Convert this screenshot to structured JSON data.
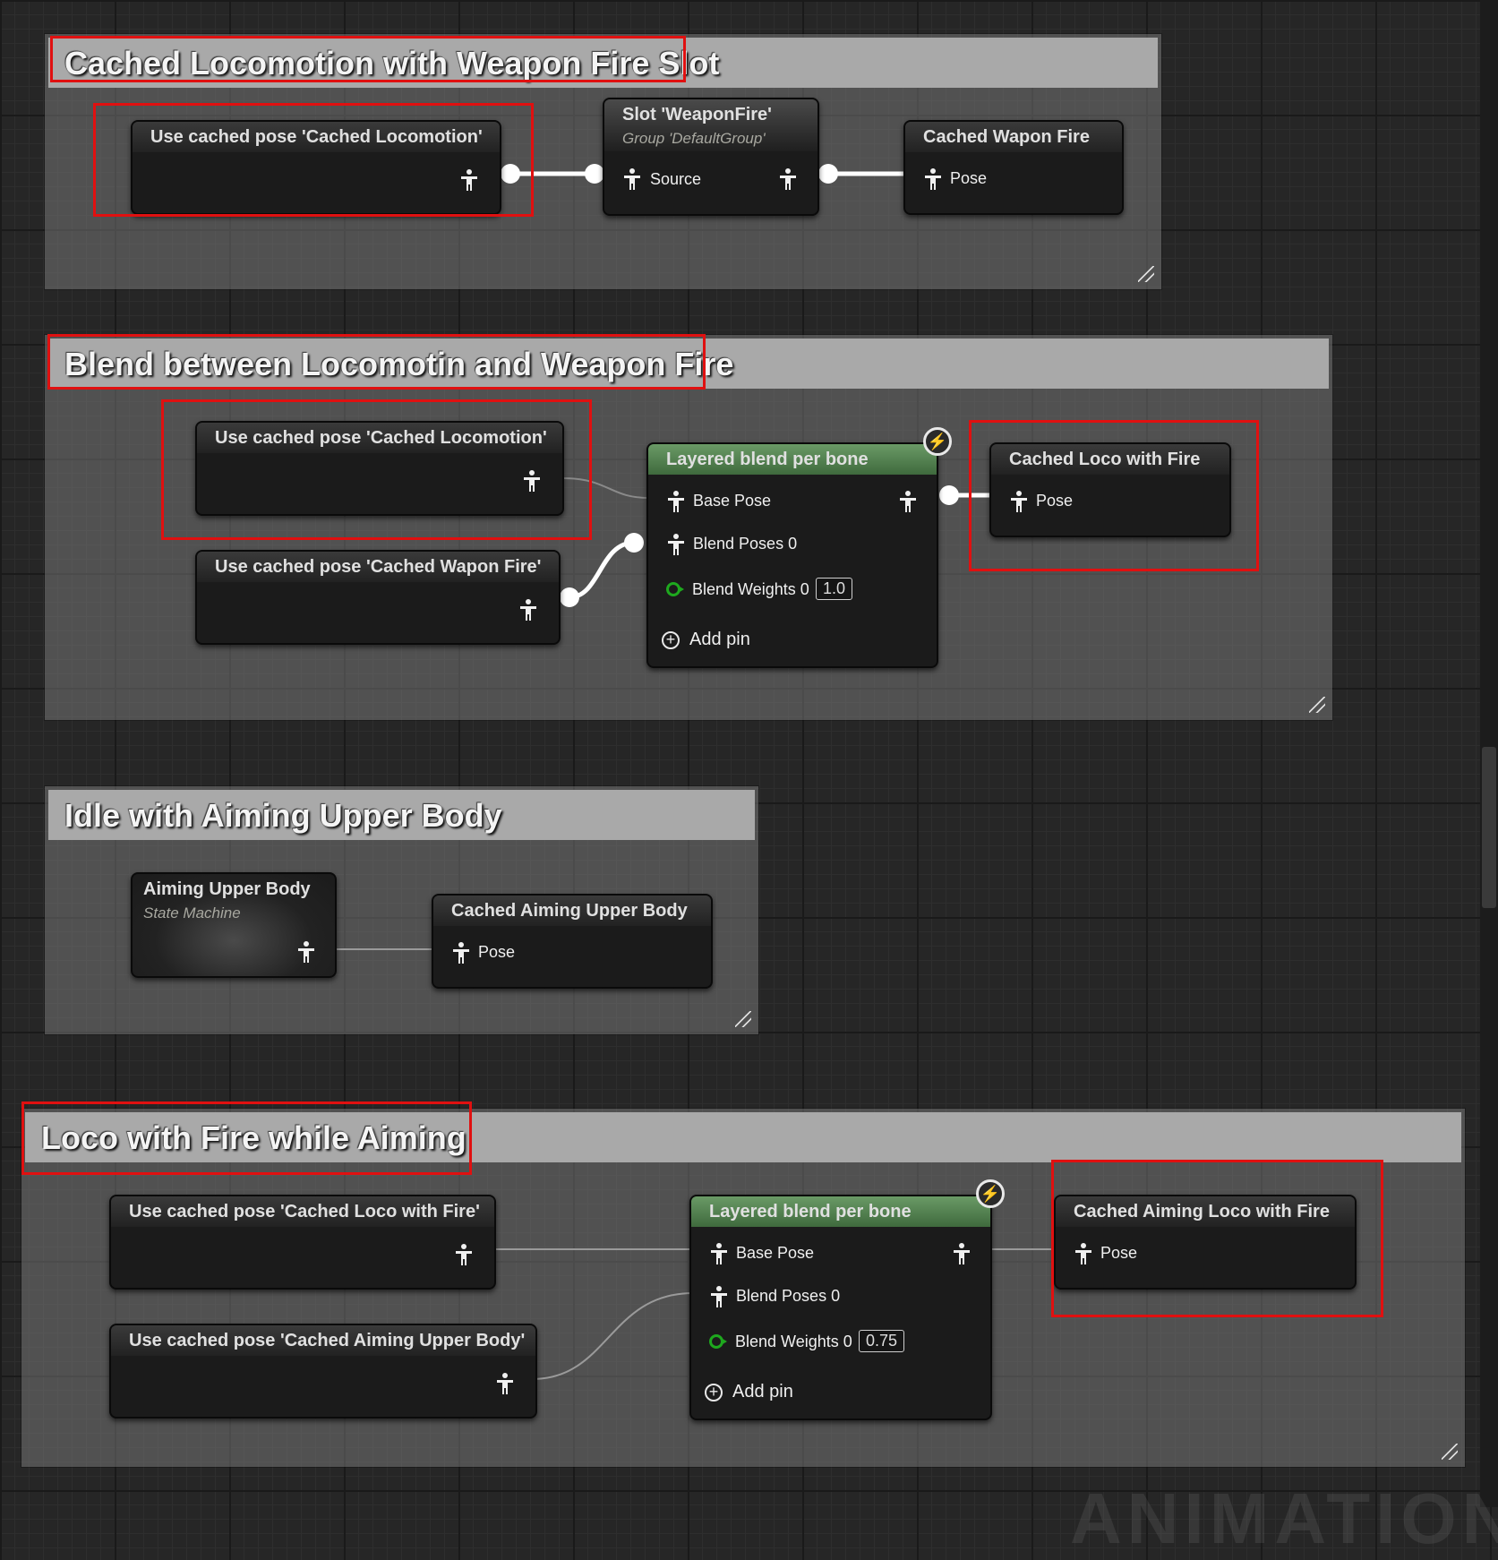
{
  "comments": {
    "c1": {
      "title": "Cached Locomotion with Weapon Fire Slot"
    },
    "c2": {
      "title": "Blend between Locomotin and Weapon Fire"
    },
    "c3": {
      "title": "Idle with Aiming Upper Body"
    },
    "c4": {
      "title": "Loco with Fire while Aiming"
    }
  },
  "nodes": {
    "use_loco_1": {
      "title": "Use cached pose 'Cached Locomotion'"
    },
    "slot": {
      "title": "Slot 'WeaponFire'",
      "subtitle": "Group 'DefaultGroup'",
      "pin_in": "Source"
    },
    "cached_wapon_fire": {
      "title": "Cached Wapon Fire",
      "pin_in": "Pose"
    },
    "use_loco_2": {
      "title": "Use cached pose 'Cached Locomotion'"
    },
    "use_wapon_fire": {
      "title": "Use cached pose 'Cached Wapon Fire'"
    },
    "blend_1": {
      "title": "Layered blend per bone",
      "base_pose": "Base Pose",
      "blend_poses": "Blend Poses 0",
      "blend_weights": "Blend Weights 0",
      "weight_value": "1.0",
      "add_pin": "Add pin"
    },
    "cached_loco_fire": {
      "title": "Cached Loco with Fire",
      "pin_in": "Pose"
    },
    "aiming_sm": {
      "title": "Aiming Upper Body",
      "subtitle": "State Machine"
    },
    "cached_aiming_ub": {
      "title": "Cached Aiming Upper Body",
      "pin_in": "Pose"
    },
    "use_loco_fire": {
      "title": "Use cached pose 'Cached Loco with Fire'"
    },
    "use_aiming_ub": {
      "title": "Use cached pose 'Cached Aiming Upper Body'"
    },
    "blend_2": {
      "title": "Layered blend per bone",
      "base_pose": "Base Pose",
      "blend_poses": "Blend Poses 0",
      "blend_weights": "Blend Weights 0",
      "weight_value": "0.75",
      "add_pin": "Add pin"
    },
    "cached_aiming_loco_fire": {
      "title": "Cached Aiming Loco with Fire",
      "pin_in": "Pose"
    }
  },
  "watermark": "ANIMATION",
  "colors": {
    "highlight": "#e01010",
    "blend_header": "#5a8a56",
    "float_pin": "#1ea81e"
  }
}
